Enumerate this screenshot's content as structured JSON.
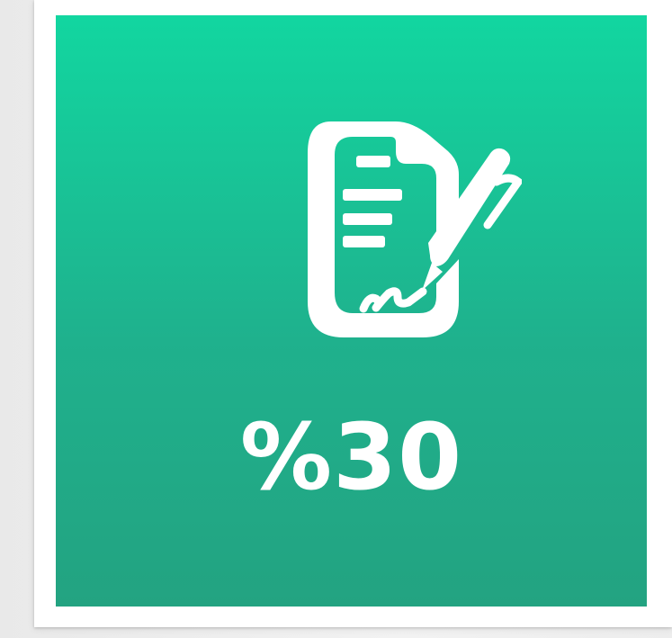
{
  "tile": {
    "value_text": "%30",
    "icon": "signed-document-pen-icon",
    "colors": {
      "gradient_top": "#12d6a0",
      "gradient_bottom": "#23a381",
      "foreground": "#ffffff",
      "card_background": "#ffffff",
      "page_background": "#f1f1f1"
    }
  }
}
